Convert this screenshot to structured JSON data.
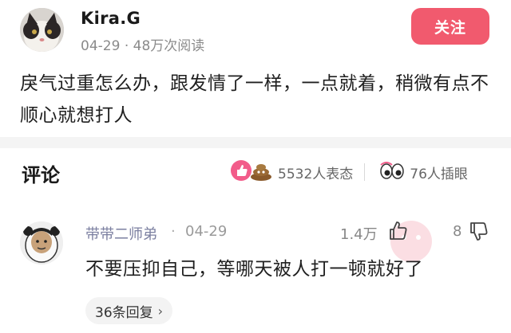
{
  "post": {
    "author": "Kira.G",
    "date": "04-29",
    "meta_dot": "·",
    "views": "48万次阅读",
    "follow_label": "关注",
    "text": "戾气过重怎么办，跟发情了一样，一点就着，稍微有点不顺心就想打人"
  },
  "comments_section": {
    "title": "评论",
    "reactions_count": "5532人表态",
    "inserts_count": "76人插眼"
  },
  "comment": {
    "username": "带带二师弟",
    "dot": "·",
    "date": "04-29",
    "likes": "1.4万",
    "dislikes": "8",
    "text": "不要压抑自己，等哪天被人打一顿就好了",
    "replies_label": "36条回复",
    "replies_chevron": "›"
  },
  "colors": {
    "accent": "#f15a6e",
    "username": "#7b7fa0"
  },
  "icons": [
    "cat-avatar-icon",
    "like-reaction-icon",
    "poop-reaction-icon",
    "eyes-icon",
    "thumbs-up-icon",
    "thumbs-down-icon",
    "panda-avatar-icon"
  ]
}
